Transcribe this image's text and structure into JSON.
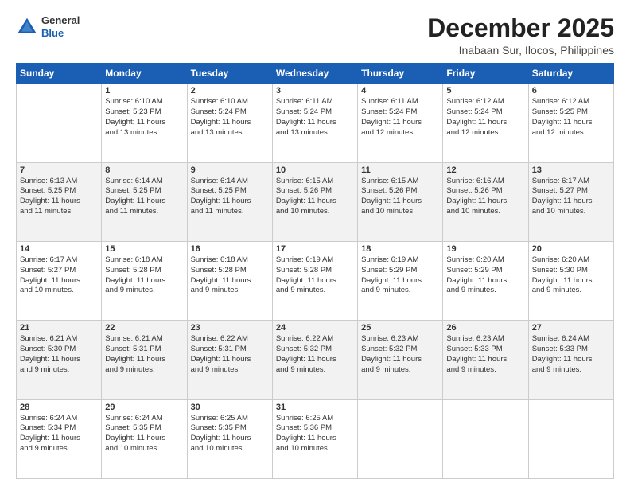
{
  "header": {
    "logo_line1": "General",
    "logo_line2": "Blue",
    "month": "December 2025",
    "location": "Inabaan Sur, Ilocos, Philippines"
  },
  "weekdays": [
    "Sunday",
    "Monday",
    "Tuesday",
    "Wednesday",
    "Thursday",
    "Friday",
    "Saturday"
  ],
  "weeks": [
    [
      {
        "day": "",
        "info": ""
      },
      {
        "day": "1",
        "info": "Sunrise: 6:10 AM\nSunset: 5:23 PM\nDaylight: 11 hours\nand 13 minutes."
      },
      {
        "day": "2",
        "info": "Sunrise: 6:10 AM\nSunset: 5:24 PM\nDaylight: 11 hours\nand 13 minutes."
      },
      {
        "day": "3",
        "info": "Sunrise: 6:11 AM\nSunset: 5:24 PM\nDaylight: 11 hours\nand 13 minutes."
      },
      {
        "day": "4",
        "info": "Sunrise: 6:11 AM\nSunset: 5:24 PM\nDaylight: 11 hours\nand 12 minutes."
      },
      {
        "day": "5",
        "info": "Sunrise: 6:12 AM\nSunset: 5:24 PM\nDaylight: 11 hours\nand 12 minutes."
      },
      {
        "day": "6",
        "info": "Sunrise: 6:12 AM\nSunset: 5:25 PM\nDaylight: 11 hours\nand 12 minutes."
      }
    ],
    [
      {
        "day": "7",
        "info": "Sunrise: 6:13 AM\nSunset: 5:25 PM\nDaylight: 11 hours\nand 11 minutes."
      },
      {
        "day": "8",
        "info": "Sunrise: 6:14 AM\nSunset: 5:25 PM\nDaylight: 11 hours\nand 11 minutes."
      },
      {
        "day": "9",
        "info": "Sunrise: 6:14 AM\nSunset: 5:25 PM\nDaylight: 11 hours\nand 11 minutes."
      },
      {
        "day": "10",
        "info": "Sunrise: 6:15 AM\nSunset: 5:26 PM\nDaylight: 11 hours\nand 10 minutes."
      },
      {
        "day": "11",
        "info": "Sunrise: 6:15 AM\nSunset: 5:26 PM\nDaylight: 11 hours\nand 10 minutes."
      },
      {
        "day": "12",
        "info": "Sunrise: 6:16 AM\nSunset: 5:26 PM\nDaylight: 11 hours\nand 10 minutes."
      },
      {
        "day": "13",
        "info": "Sunrise: 6:17 AM\nSunset: 5:27 PM\nDaylight: 11 hours\nand 10 minutes."
      }
    ],
    [
      {
        "day": "14",
        "info": "Sunrise: 6:17 AM\nSunset: 5:27 PM\nDaylight: 11 hours\nand 10 minutes."
      },
      {
        "day": "15",
        "info": "Sunrise: 6:18 AM\nSunset: 5:28 PM\nDaylight: 11 hours\nand 9 minutes."
      },
      {
        "day": "16",
        "info": "Sunrise: 6:18 AM\nSunset: 5:28 PM\nDaylight: 11 hours\nand 9 minutes."
      },
      {
        "day": "17",
        "info": "Sunrise: 6:19 AM\nSunset: 5:28 PM\nDaylight: 11 hours\nand 9 minutes."
      },
      {
        "day": "18",
        "info": "Sunrise: 6:19 AM\nSunset: 5:29 PM\nDaylight: 11 hours\nand 9 minutes."
      },
      {
        "day": "19",
        "info": "Sunrise: 6:20 AM\nSunset: 5:29 PM\nDaylight: 11 hours\nand 9 minutes."
      },
      {
        "day": "20",
        "info": "Sunrise: 6:20 AM\nSunset: 5:30 PM\nDaylight: 11 hours\nand 9 minutes."
      }
    ],
    [
      {
        "day": "21",
        "info": "Sunrise: 6:21 AM\nSunset: 5:30 PM\nDaylight: 11 hours\nand 9 minutes."
      },
      {
        "day": "22",
        "info": "Sunrise: 6:21 AM\nSunset: 5:31 PM\nDaylight: 11 hours\nand 9 minutes."
      },
      {
        "day": "23",
        "info": "Sunrise: 6:22 AM\nSunset: 5:31 PM\nDaylight: 11 hours\nand 9 minutes."
      },
      {
        "day": "24",
        "info": "Sunrise: 6:22 AM\nSunset: 5:32 PM\nDaylight: 11 hours\nand 9 minutes."
      },
      {
        "day": "25",
        "info": "Sunrise: 6:23 AM\nSunset: 5:32 PM\nDaylight: 11 hours\nand 9 minutes."
      },
      {
        "day": "26",
        "info": "Sunrise: 6:23 AM\nSunset: 5:33 PM\nDaylight: 11 hours\nand 9 minutes."
      },
      {
        "day": "27",
        "info": "Sunrise: 6:24 AM\nSunset: 5:33 PM\nDaylight: 11 hours\nand 9 minutes."
      }
    ],
    [
      {
        "day": "28",
        "info": "Sunrise: 6:24 AM\nSunset: 5:34 PM\nDaylight: 11 hours\nand 9 minutes."
      },
      {
        "day": "29",
        "info": "Sunrise: 6:24 AM\nSunset: 5:35 PM\nDaylight: 11 hours\nand 10 minutes."
      },
      {
        "day": "30",
        "info": "Sunrise: 6:25 AM\nSunset: 5:35 PM\nDaylight: 11 hours\nand 10 minutes."
      },
      {
        "day": "31",
        "info": "Sunrise: 6:25 AM\nSunset: 5:36 PM\nDaylight: 11 hours\nand 10 minutes."
      },
      {
        "day": "",
        "info": ""
      },
      {
        "day": "",
        "info": ""
      },
      {
        "day": "",
        "info": ""
      }
    ]
  ]
}
